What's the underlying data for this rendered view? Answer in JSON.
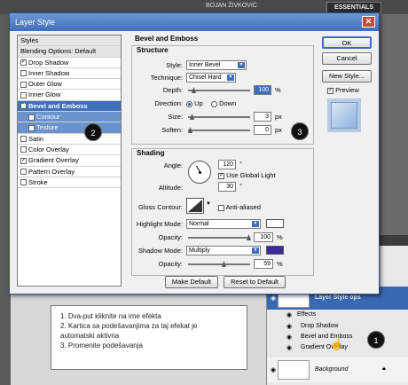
{
  "background": {
    "user_name": "BOJAN ŽIVKOVIĆ",
    "workspace": "ESSENTIALS",
    "layers": {
      "layer_name": "Layer Style ops",
      "effects_label": "Effects",
      "effects": [
        "Drop Shadow",
        "Bevel and Emboss",
        "Gradient Overlay"
      ],
      "background_layer": "Background"
    }
  },
  "dialog": {
    "title": "Layer Style",
    "close_label": "✕",
    "styles_header": "Styles",
    "blending_options": "Blending Options: Default",
    "style_items": [
      {
        "label": "Drop Shadow",
        "checked": "✓"
      },
      {
        "label": "Inner Shadow",
        "checked": ""
      },
      {
        "label": "Outer Glow",
        "checked": ""
      },
      {
        "label": "Inner Glow",
        "checked": ""
      },
      {
        "label": "Bevel and Emboss",
        "checked": "✓"
      },
      {
        "label": "Contour",
        "checked": ""
      },
      {
        "label": "Texture",
        "checked": ""
      },
      {
        "label": "Satin",
        "checked": ""
      },
      {
        "label": "Color Overlay",
        "checked": ""
      },
      {
        "label": "Gradient Overlay",
        "checked": "✓"
      },
      {
        "label": "Pattern Overlay",
        "checked": ""
      },
      {
        "label": "Stroke",
        "checked": ""
      }
    ],
    "section_title": "Bevel and Emboss",
    "structure": {
      "title": "Structure",
      "style_label": "Style:",
      "style_value": "Inner Bevel",
      "technique_label": "Technique:",
      "technique_value": "Chisel Hard",
      "depth_label": "Depth:",
      "depth_value": "100",
      "depth_unit": "%",
      "direction_label": "Direction:",
      "direction_up": "Up",
      "direction_down": "Down",
      "size_label": "Size:",
      "size_value": "3",
      "size_unit": "px",
      "soften_label": "Soften:",
      "soften_value": "0",
      "soften_unit": "px"
    },
    "shading": {
      "title": "Shading",
      "angle_label": "Angle:",
      "angle_value": "120",
      "angle_unit": "°",
      "use_global_light": "Use Global Light",
      "altitude_label": "Altitude:",
      "altitude_value": "30",
      "altitude_unit": "°",
      "gloss_contour_label": "Gloss Contour:",
      "anti_aliased": "Anti-aliased",
      "highlight_mode_label": "Highlight Mode:",
      "highlight_mode_value": "Normal",
      "highlight_opacity_label": "Opacity:",
      "highlight_opacity_value": "100",
      "shadow_mode_label": "Shadow Mode:",
      "shadow_mode_value": "Multiply",
      "shadow_opacity_label": "Opacity:",
      "shadow_opacity_value": "59",
      "percent": "%",
      "highlight_color": "#ffffff",
      "shadow_color": "#3a2a9a"
    },
    "make_default": "Make Default",
    "reset_to_default": "Reset to Default",
    "ok": "OK",
    "cancel": "Cancel",
    "new_style": "New Style...",
    "preview_label": "Preview"
  },
  "badges": {
    "b1": "1",
    "b2": "2",
    "b3": "3"
  },
  "note": {
    "lines": [
      "1. Dva-put kliknite na ime efekta",
      "2. Kartica sa podešavanjima za taj efekat je",
      "    automatski aktivna",
      "3. Promenite podešavanja"
    ]
  },
  "colors": {
    "accent": "#3f6fba",
    "selected": "#3f6fba"
  }
}
